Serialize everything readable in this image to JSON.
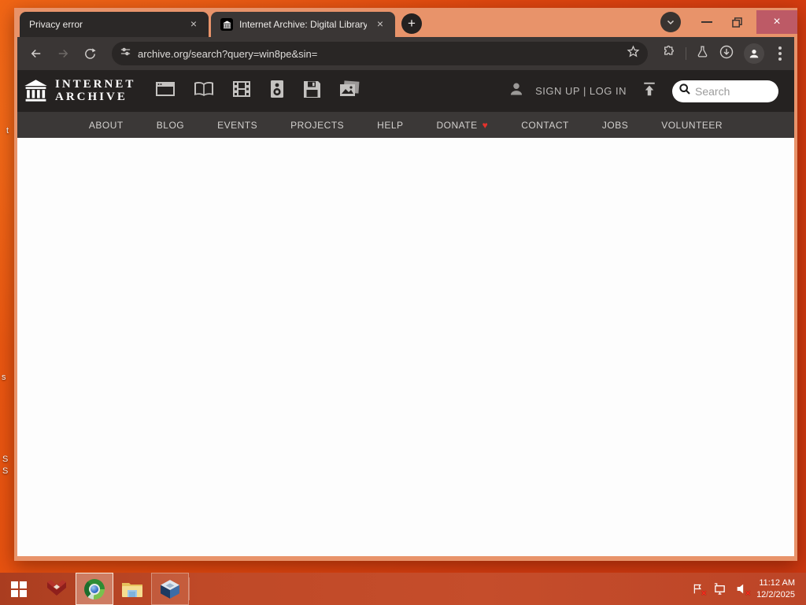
{
  "desktop": {
    "fragments": [
      "t",
      "s",
      "S",
      "S"
    ]
  },
  "browser": {
    "tabs": [
      {
        "title": "Privacy error"
      },
      {
        "title": "Internet Archive: Digital Library"
      }
    ],
    "tab_close_glyph": "×",
    "new_tab_glyph": "+",
    "window_controls": {
      "close_glyph": "×"
    },
    "address": "archive.org/search?query=win8pe&sin="
  },
  "ia": {
    "logo_line1": "INTERNET",
    "logo_line2": "ARCHIVE",
    "signup_login": "SIGN UP | LOG IN",
    "search_placeholder": "Search",
    "nav": [
      {
        "label": "ABOUT"
      },
      {
        "label": "BLOG"
      },
      {
        "label": "EVENTS"
      },
      {
        "label": "PROJECTS"
      },
      {
        "label": "HELP"
      },
      {
        "label": "DONATE"
      },
      {
        "label": "CONTACT"
      },
      {
        "label": "JOBS"
      },
      {
        "label": "VOLUNTEER"
      }
    ],
    "donate_heart": "♥"
  },
  "taskbar": {
    "clock": {
      "time": "11:12 AM",
      "date": "12/2/2025"
    }
  },
  "colors": {
    "accent_frame": "#e8936a",
    "toolbar_dark": "#3a3635",
    "ia_header": "#252221",
    "taskbar_red": "#c04a28",
    "donate_heart": "#e5312b",
    "close_button": "#bd5a66"
  }
}
